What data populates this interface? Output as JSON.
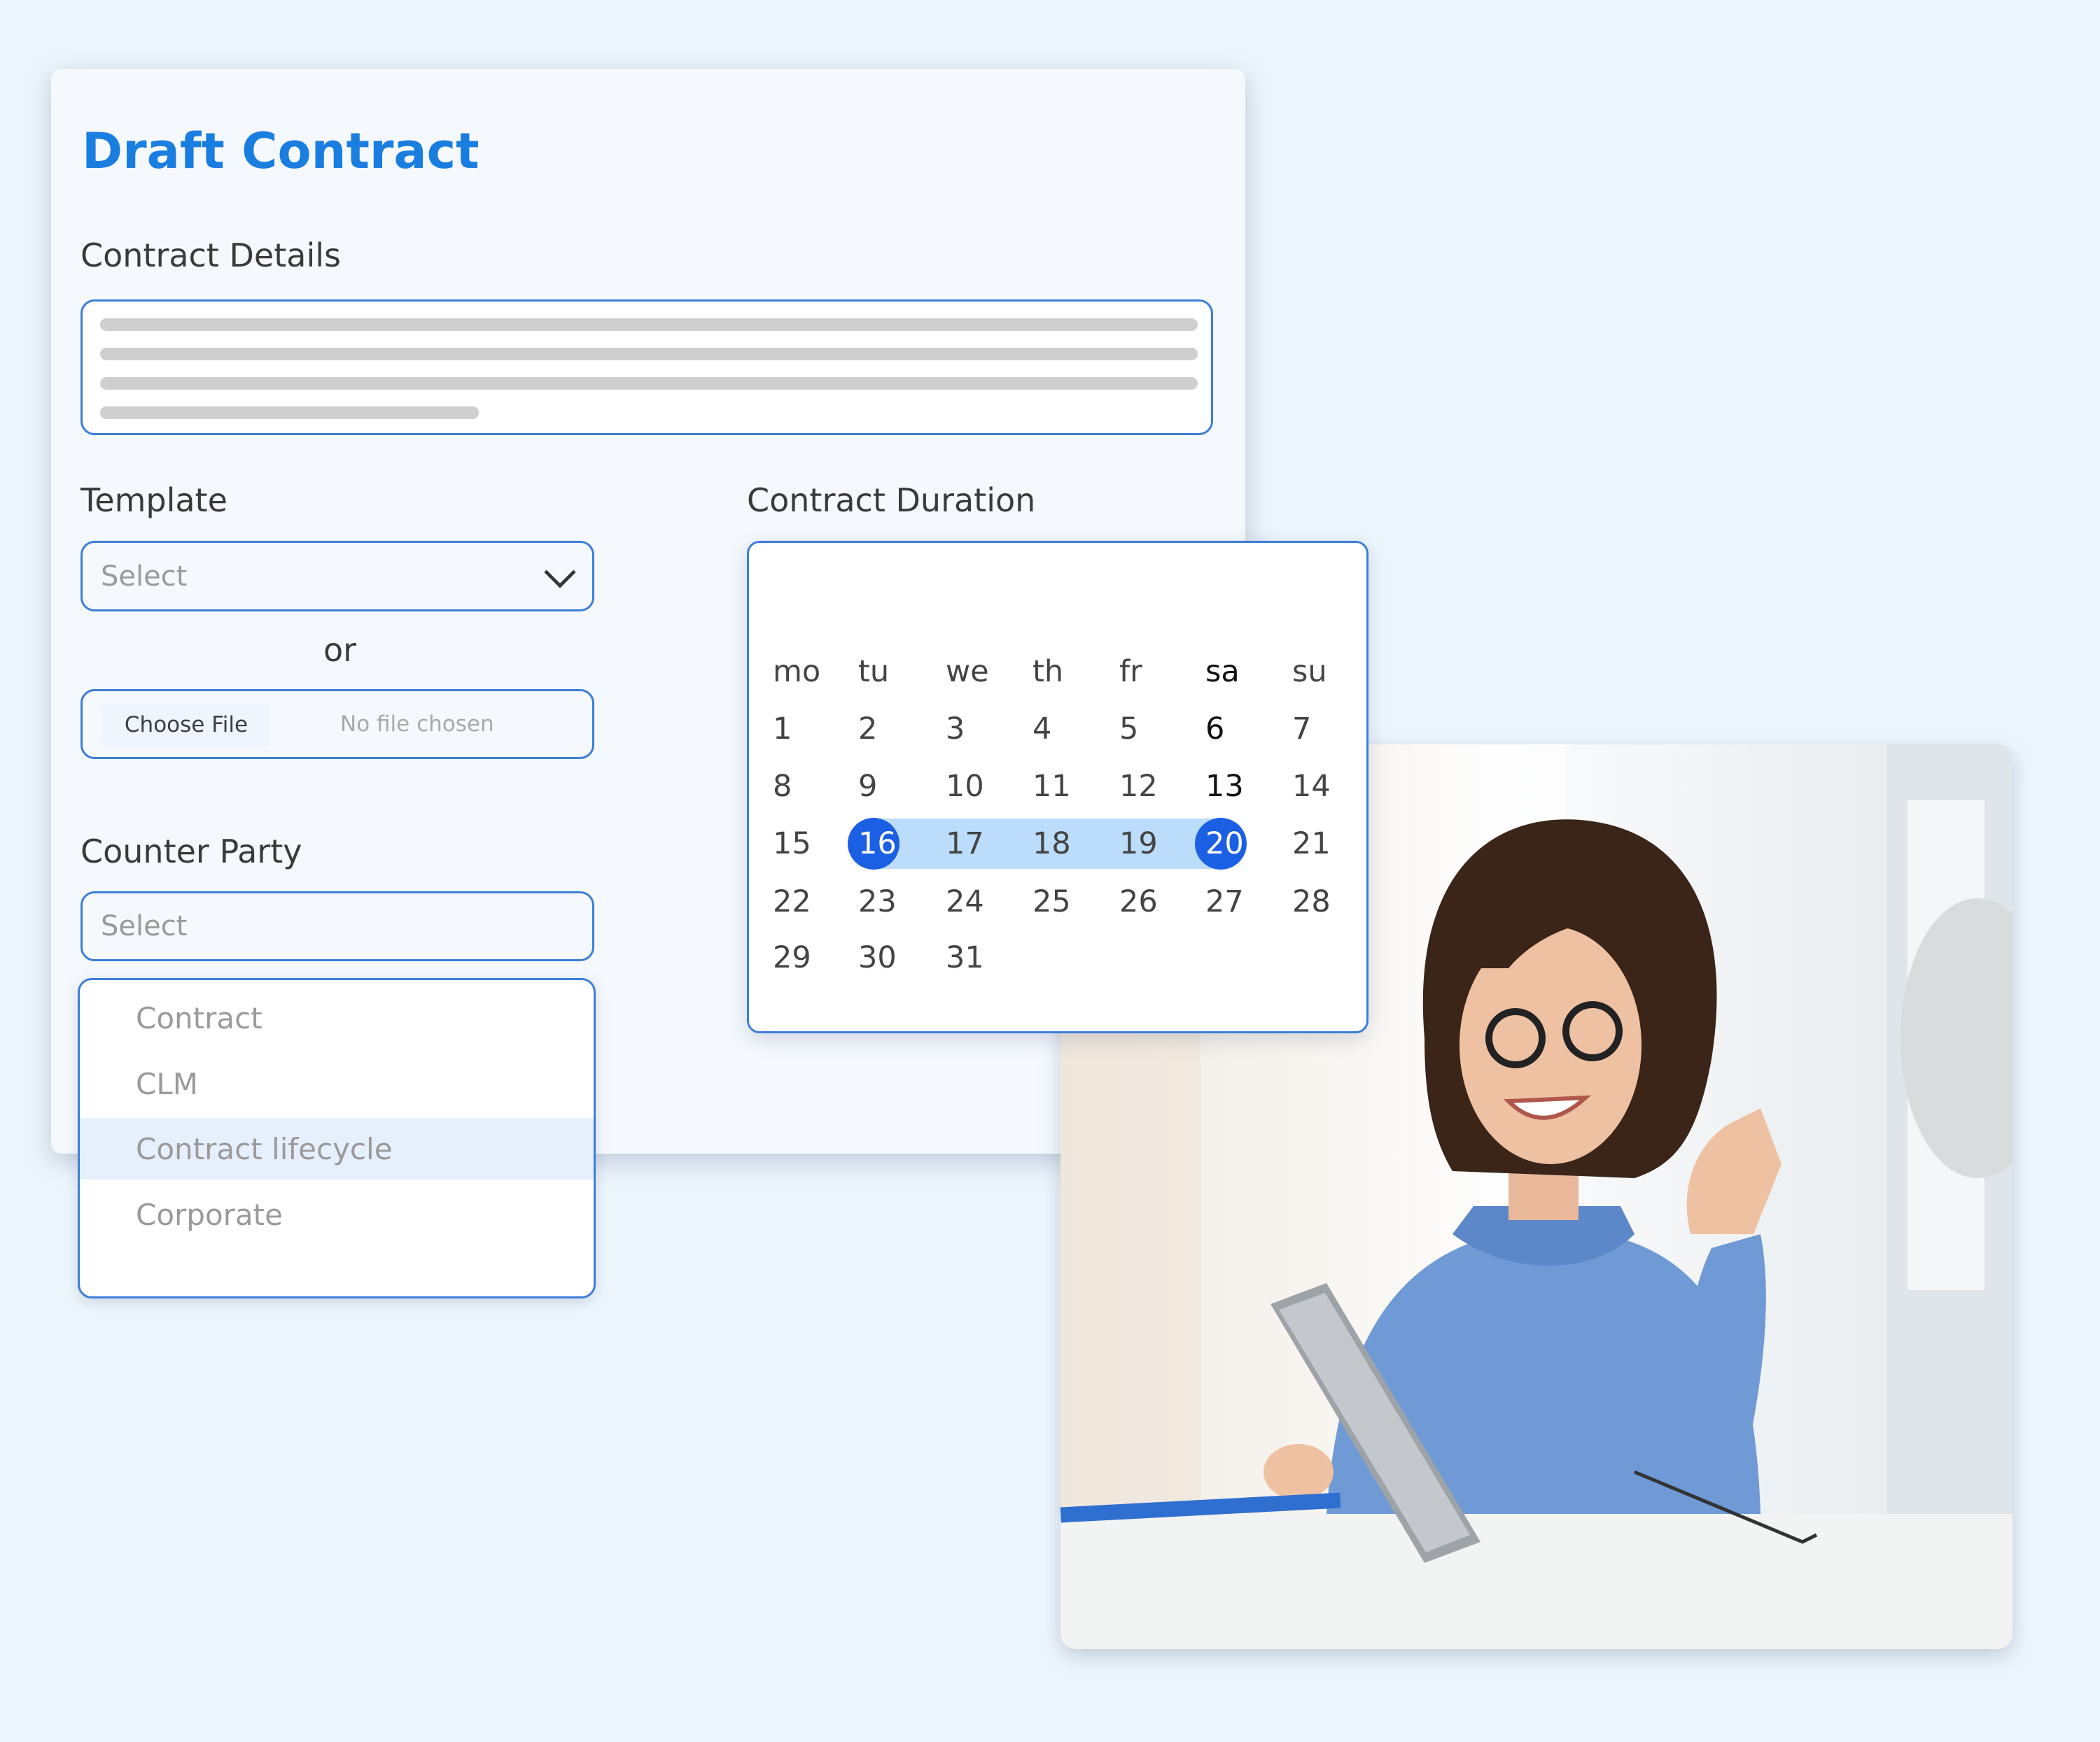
{
  "form": {
    "title": "Draft Contract",
    "details_label": "Contract Details",
    "template_label": "Template",
    "template_placeholder": "Select",
    "or_label": "or",
    "file_button": "Choose File",
    "file_status": "No file chosen",
    "counter_party_label": "Counter Party",
    "counter_party_placeholder": "Select",
    "counter_party_options": [
      "Contract",
      "CLM",
      "Contract lifecycle",
      "Corporate"
    ],
    "highlighted_option": "Contract lifecycle",
    "duration_label": "Contract Duration"
  },
  "calendar": {
    "weekdays": [
      "mo",
      "tu",
      "we",
      "th",
      "fr",
      "sa",
      "su"
    ],
    "days_in_month": 31,
    "range_start": 16,
    "range_end": 20,
    "emphasized_days": [
      6,
      13
    ],
    "emphasized_weekday": "sa"
  },
  "colors": {
    "accent": "#1a7de0",
    "border": "#3d7ed6",
    "selected": "#1b5fe4",
    "range": "#bcdcfb"
  }
}
